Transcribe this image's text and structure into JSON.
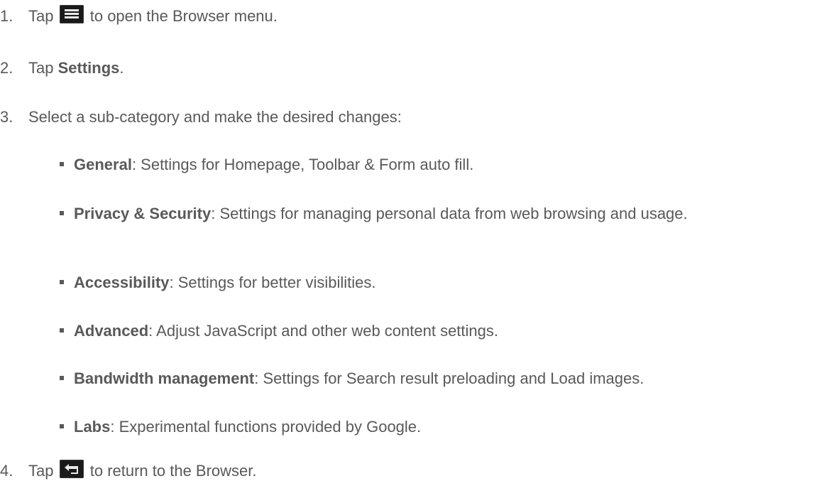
{
  "steps": [
    {
      "number": "1.",
      "before": "Tap",
      "icon": "menu-icon",
      "after": "to open the Browser menu."
    },
    {
      "number": "2.",
      "before": "Tap",
      "bold": "Settings",
      "after": "."
    },
    {
      "number": "3.",
      "text": "Select a sub-category and make the desired changes:"
    },
    {
      "number": "4.",
      "before": "Tap",
      "icon": "back-icon",
      "after": "to return to the Browser."
    }
  ],
  "subcategories": [
    {
      "title": "General",
      "description": ": Settings for Homepage, Toolbar & Form auto fill."
    },
    {
      "title": "Privacy & Security",
      "description": ": Settings for managing personal data from web browsing and usage."
    },
    {
      "title": "Accessibility",
      "description": ": Settings for better visibilities."
    },
    {
      "title": "Advanced",
      "description": ": Adjust JavaScript and other web content settings."
    },
    {
      "title": "Bandwidth management",
      "description": ": Settings for Search result preloading and Load images."
    },
    {
      "title": "Labs",
      "description": ": Experimental functions provided by Google."
    }
  ]
}
